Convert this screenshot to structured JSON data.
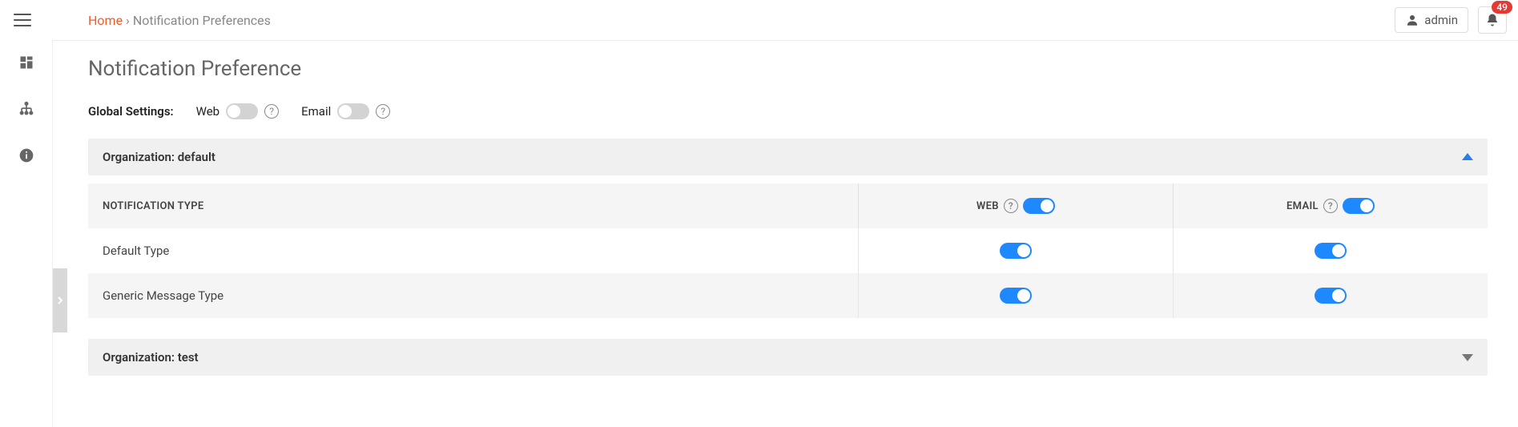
{
  "breadcrumb": {
    "home": "Home",
    "sep": " › ",
    "current": "Notification Preferences"
  },
  "user": {
    "name": "admin"
  },
  "notifications": {
    "count": "49"
  },
  "page": {
    "title": "Notification Preference"
  },
  "global": {
    "label": "Global Settings:",
    "web_label": "Web",
    "email_label": "Email",
    "web_on": false,
    "email_on": false
  },
  "panels": [
    {
      "title": "Organization: default",
      "expanded": true,
      "columns": {
        "type": "NOTIFICATION TYPE",
        "web": "WEB",
        "email": "EMAIL"
      },
      "header_web_on": true,
      "header_email_on": true,
      "rows": [
        {
          "name": "Default Type",
          "web_on": true,
          "email_on": true
        },
        {
          "name": "Generic Message Type",
          "web_on": true,
          "email_on": true
        }
      ]
    },
    {
      "title": "Organization: test",
      "expanded": false
    }
  ]
}
